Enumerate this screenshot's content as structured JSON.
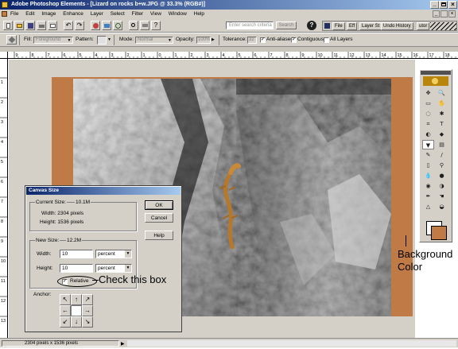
{
  "window": {
    "title": "Adobe Photoshop Elements - [Lizard on rocks b+w.JPG @ 33.3% (RGB#)]"
  },
  "window_controls": [
    "minimize",
    "maximize",
    "close"
  ],
  "menu": [
    "File",
    "Edit",
    "Image",
    "Enhance",
    "Layer",
    "Select",
    "Filter",
    "View",
    "Window",
    "Help"
  ],
  "shortcuts": {
    "search_placeholder": "Enter search criteria",
    "search_button": "Search",
    "palette_tabs": [
      "File",
      "Eff",
      "Layer St",
      "Undo History",
      "utor"
    ]
  },
  "options": {
    "fill_label": "Fill:",
    "fill_value": "Foreground",
    "pattern_label": "Pattern:",
    "mode_label": "Mode:",
    "mode_value": "Normal",
    "opacity_label": "Opacity:",
    "opacity_value": "100%",
    "tolerance_label": "Tolerance:",
    "tolerance_value": "32",
    "anti_aliased": "Anti-aliased",
    "contiguous": "Contiguous",
    "all_layers": "All Layers"
  },
  "ruler": {
    "h_labels": [
      "9",
      "8",
      "7",
      "6",
      "5",
      "4",
      "3",
      "2",
      "1",
      "0",
      "1",
      "2",
      "3",
      "4",
      "5",
      "6",
      "7",
      "8",
      "9",
      "10",
      "11",
      "12",
      "13",
      "14",
      "15",
      "16",
      "17",
      "18"
    ],
    "v_labels": [
      "1",
      "2",
      "3",
      "4",
      "5",
      "6",
      "7",
      "8",
      "9",
      "10",
      "11",
      "12",
      "13"
    ]
  },
  "dialog": {
    "title": "Canvas Size",
    "current_size_label": "Current Size:",
    "current_size_value": "10.1M",
    "current_width": "Width:  2304 pixels",
    "current_height": "Height:  1536 pixels",
    "new_size_label": "New Size:",
    "new_size_value": "12.2M",
    "width_label": "Width:",
    "width_value": "10",
    "width_unit": "percent",
    "height_label": "Height:",
    "height_value": "10",
    "height_unit": "percent",
    "relative_label": "Relative",
    "anchor_label": "Anchor:",
    "ok": "OK",
    "cancel": "Cancel",
    "help": "Help"
  },
  "annotations": {
    "check_box": "Check this box",
    "background_line1": "Background",
    "background_line2": "Color"
  },
  "status": {
    "text": "2304 pixels x 1536 pixels"
  },
  "colors": {
    "canvas_background": "#c07a45",
    "title_bar": "#0a246a",
    "chrome": "#d4d0c8"
  }
}
